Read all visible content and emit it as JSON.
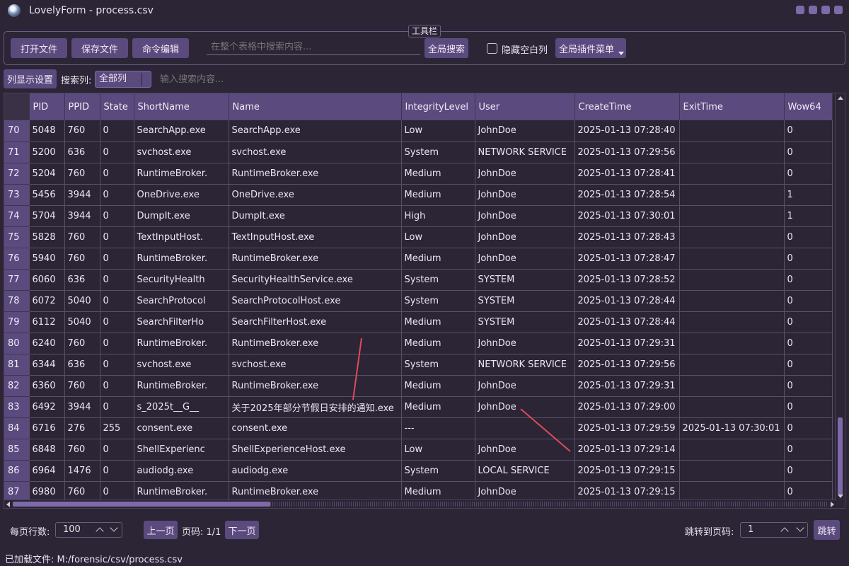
{
  "window": {
    "title": "LovelyForm - process.csv"
  },
  "toolbar": {
    "caption": "工具栏",
    "open_label": "打开文件",
    "save_label": "保存文件",
    "cmd_label": "命令编辑",
    "global_search_placeholder": "在整个表格中搜索内容...",
    "global_search_button": "全局搜索",
    "hide_blank_label": "隐藏空白列",
    "plugin_menu_label": "全局插件菜单"
  },
  "searchbar": {
    "column_settings_label": "列显示设置",
    "search_col_label": "搜索列:",
    "search_col_value": "全部列",
    "search_placeholder": "输入搜索内容..."
  },
  "table": {
    "columns": [
      "PID",
      "PPID",
      "State",
      "ShortName",
      "Name",
      "IntegrityLevel",
      "User",
      "CreateTime",
      "ExitTime",
      "Wow64"
    ],
    "rows": [
      {
        "n": "70",
        "cells": [
          "5048",
          "760",
          "0",
          "SearchApp.exe",
          "SearchApp.exe",
          "Low",
          "JohnDoe",
          "2025-01-13 07:28:40",
          "",
          "0"
        ]
      },
      {
        "n": "71",
        "cells": [
          "5200",
          "636",
          "0",
          "svchost.exe",
          "svchost.exe",
          "System",
          "NETWORK SERVICE",
          "2025-01-13 07:29:56",
          "",
          "0"
        ]
      },
      {
        "n": "72",
        "cells": [
          "5204",
          "760",
          "0",
          "RuntimeBroker.",
          "RuntimeBroker.exe",
          "Medium",
          "JohnDoe",
          "2025-01-13 07:28:41",
          "",
          "0"
        ]
      },
      {
        "n": "73",
        "cells": [
          "5456",
          "3944",
          "0",
          "OneDrive.exe",
          "OneDrive.exe",
          "Medium",
          "JohnDoe",
          "2025-01-13 07:28:54",
          "",
          "1"
        ]
      },
      {
        "n": "74",
        "cells": [
          "5704",
          "3944",
          "0",
          "DumpIt.exe",
          "DumpIt.exe",
          "High",
          "JohnDoe",
          "2025-01-13 07:30:01",
          "",
          "1"
        ]
      },
      {
        "n": "75",
        "cells": [
          "5828",
          "760",
          "0",
          "TextInputHost.",
          "TextInputHost.exe",
          "Low",
          "JohnDoe",
          "2025-01-13 07:28:43",
          "",
          "0"
        ]
      },
      {
        "n": "76",
        "cells": [
          "5940",
          "760",
          "0",
          "RuntimeBroker.",
          "RuntimeBroker.exe",
          "Medium",
          "JohnDoe",
          "2025-01-13 07:28:47",
          "",
          "0"
        ]
      },
      {
        "n": "77",
        "cells": [
          "6060",
          "636",
          "0",
          "SecurityHealth",
          "SecurityHealthService.exe",
          "System",
          "SYSTEM",
          "2025-01-13 07:28:52",
          "",
          "0"
        ]
      },
      {
        "n": "78",
        "cells": [
          "6072",
          "5040",
          "0",
          "SearchProtocol",
          "SearchProtocolHost.exe",
          "System",
          "SYSTEM",
          "2025-01-13 07:28:44",
          "",
          "0"
        ]
      },
      {
        "n": "79",
        "cells": [
          "6112",
          "5040",
          "0",
          "SearchFilterHo",
          "SearchFilterHost.exe",
          "Medium",
          "SYSTEM",
          "2025-01-13 07:28:44",
          "",
          "0"
        ]
      },
      {
        "n": "80",
        "cells": [
          "6240",
          "760",
          "0",
          "RuntimeBroker.",
          "RuntimeBroker.exe",
          "Medium",
          "JohnDoe",
          "2025-01-13 07:29:31",
          "",
          "0"
        ]
      },
      {
        "n": "81",
        "cells": [
          "6344",
          "636",
          "0",
          "svchost.exe",
          "svchost.exe",
          "System",
          "NETWORK SERVICE",
          "2025-01-13 07:29:56",
          "",
          "0"
        ]
      },
      {
        "n": "82",
        "cells": [
          "6360",
          "760",
          "0",
          "RuntimeBroker.",
          "RuntimeBroker.exe",
          "Medium",
          "JohnDoe",
          "2025-01-13 07:29:31",
          "",
          "0"
        ]
      },
      {
        "n": "83",
        "cells": [
          "6492",
          "3944",
          "0",
          "s_2025t__G__",
          "关于2025年部分节假日安排的通知.exe",
          "Medium",
          "JohnDoe",
          "2025-01-13 07:29:00",
          "",
          "0"
        ]
      },
      {
        "n": "84",
        "cells": [
          "6716",
          "276",
          "255",
          "consent.exe",
          "consent.exe",
          "---",
          "",
          "2025-01-13 07:29:59",
          "2025-01-13 07:30:01",
          "0"
        ]
      },
      {
        "n": "85",
        "cells": [
          "6848",
          "760",
          "0",
          "ShellExperienc",
          "ShellExperienceHost.exe",
          "Low",
          "JohnDoe",
          "2025-01-13 07:29:14",
          "",
          "0"
        ]
      },
      {
        "n": "86",
        "cells": [
          "6964",
          "1476",
          "0",
          "audiodg.exe",
          "audiodg.exe",
          "System",
          "LOCAL SERVICE",
          "2025-01-13 07:29:15",
          "",
          "0"
        ]
      },
      {
        "n": "87",
        "cells": [
          "6980",
          "760",
          "0",
          "RuntimeBroker.",
          "RuntimeBroker.exe",
          "Medium",
          "JohnDoe",
          "2025-01-13 07:29:15",
          "",
          "0"
        ]
      }
    ]
  },
  "pager": {
    "rows_per_page_label": "每页行数:",
    "rows_per_page_value": "100",
    "prev_label": "上一页",
    "page_label": "页码: 1/1",
    "next_label": "下一页",
    "jump_label": "跳转到页码:",
    "jump_value": "1",
    "jump_button": "跳转"
  },
  "status": {
    "text": "已加载文件: M:/forensic/csv/process.csv"
  },
  "colors": {
    "background": "#2b2535",
    "accent": "#5b4a7d",
    "annotation": "#e04a5a"
  }
}
